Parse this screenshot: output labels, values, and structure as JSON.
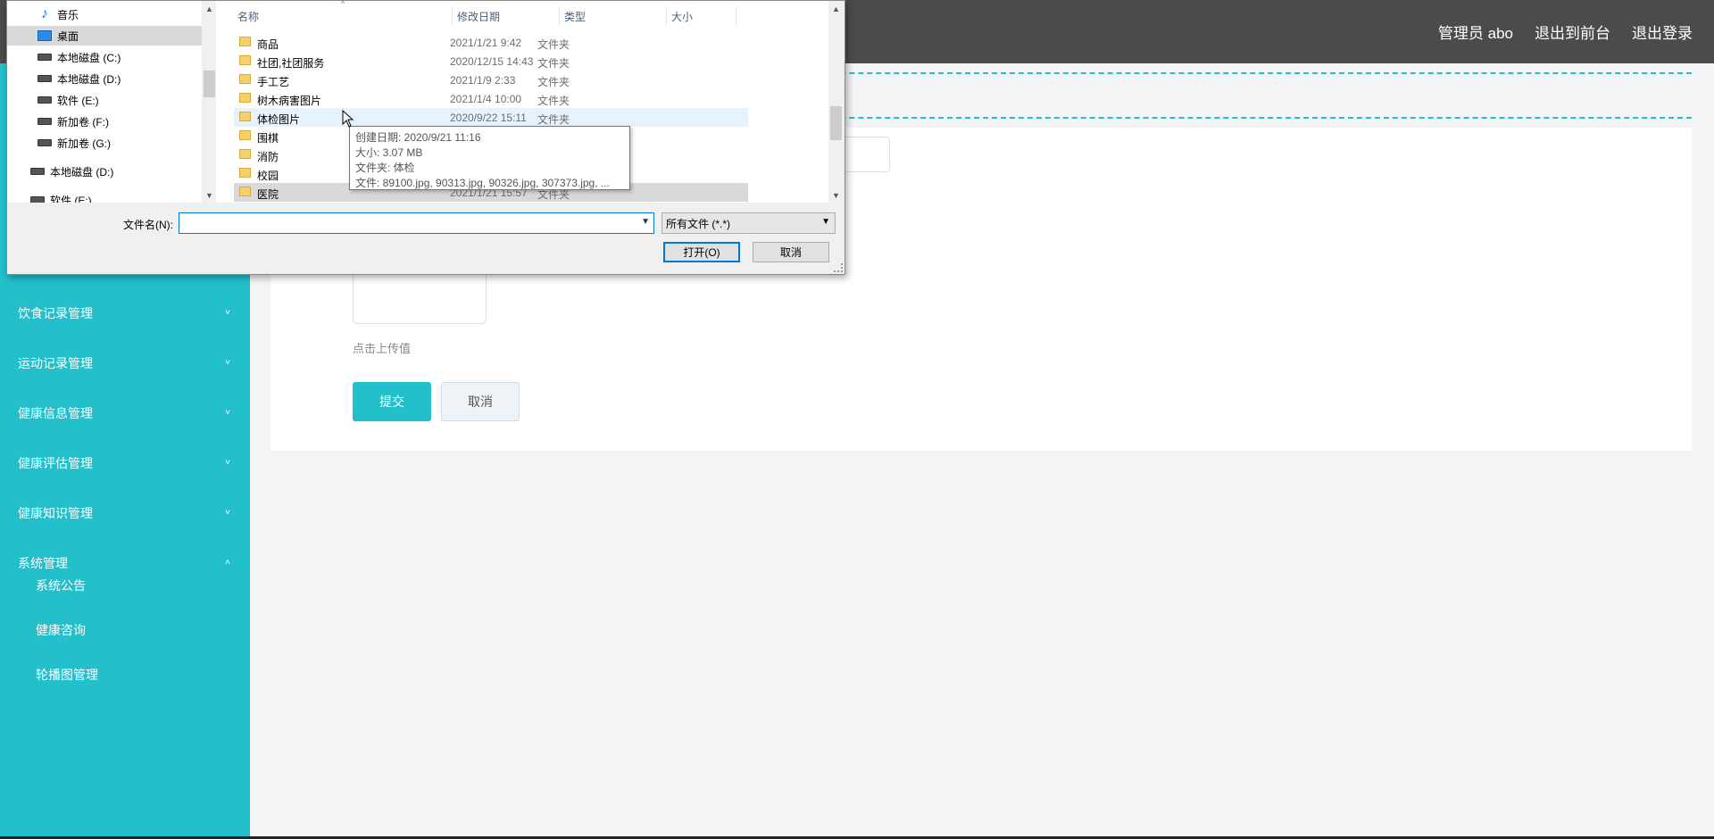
{
  "header": {
    "admin_label": "管理员 abo",
    "frontend_link": "退出到前台",
    "logout_link": "退出登录"
  },
  "sidebar": {
    "items": [
      {
        "label": "饮食记录管理",
        "chevron": "˅"
      },
      {
        "label": "运动记录管理",
        "chevron": "˅"
      },
      {
        "label": "健康信息管理",
        "chevron": "˅"
      },
      {
        "label": "健康评估管理",
        "chevron": "˅"
      },
      {
        "label": "健康知识管理",
        "chevron": "˅"
      },
      {
        "label": "系统管理",
        "chevron": "˄"
      }
    ],
    "subitems": [
      {
        "label": "系统公告"
      },
      {
        "label": "健康咨询"
      },
      {
        "label": "轮播图管理"
      }
    ]
  },
  "form": {
    "upload_hint": "点击上传值",
    "submit_label": "提交",
    "cancel_label": "取消"
  },
  "dialog": {
    "nav": [
      {
        "label": "音乐",
        "icon": "music-icon"
      },
      {
        "label": "桌面",
        "icon": "desktop-icon"
      },
      {
        "label": "本地磁盘 (C:)",
        "icon": "drive-icon"
      },
      {
        "label": "本地磁盘 (D:)",
        "icon": "drive-icon"
      },
      {
        "label": "软件 (E:)",
        "icon": "drive-icon"
      },
      {
        "label": "新加卷 (F:)",
        "icon": "drive-icon"
      },
      {
        "label": "新加卷 (G:)",
        "icon": "drive-icon"
      },
      {
        "label": "本地磁盘 (D:)",
        "icon": "drive-icon"
      },
      {
        "label": "软件 (E:)",
        "icon": "drive-icon"
      }
    ],
    "columns": {
      "name": "名称",
      "date": "修改日期",
      "type": "类型",
      "size": "大小"
    },
    "files": [
      {
        "name": "商品",
        "date": "2021/1/21 9:42",
        "type": "文件夹"
      },
      {
        "name": "社团,社团服务",
        "date": "2020/12/15 14:43",
        "type": "文件夹"
      },
      {
        "name": "手工艺",
        "date": "2021/1/9 2:33",
        "type": "文件夹"
      },
      {
        "name": "树木病害图片",
        "date": "2021/1/4 10:00",
        "type": "文件夹"
      },
      {
        "name": "体检图片",
        "date": "2020/9/22 15:11",
        "type": "文件夹"
      },
      {
        "name": "围棋",
        "date": "",
        "type": ""
      },
      {
        "name": "消防",
        "date": "",
        "type": ""
      },
      {
        "name": "校园",
        "date": "",
        "type": ""
      },
      {
        "name": "医院",
        "date": "2021/1/21 15:57",
        "type": "文件夹"
      }
    ],
    "tooltip": {
      "created": "创建日期: 2020/9/21 11:16",
      "size": "大小: 3.07 MB",
      "folders": "文件夹: 体检",
      "files": "文件: 89100.jpg, 90313.jpg, 90326.jpg, 307373.jpg, ..."
    },
    "filename_label": "文件名(N):",
    "filename_value": "",
    "filter_value": "所有文件 (*.*)",
    "open_label": "打开(O)",
    "cancel_label": "取消"
  }
}
